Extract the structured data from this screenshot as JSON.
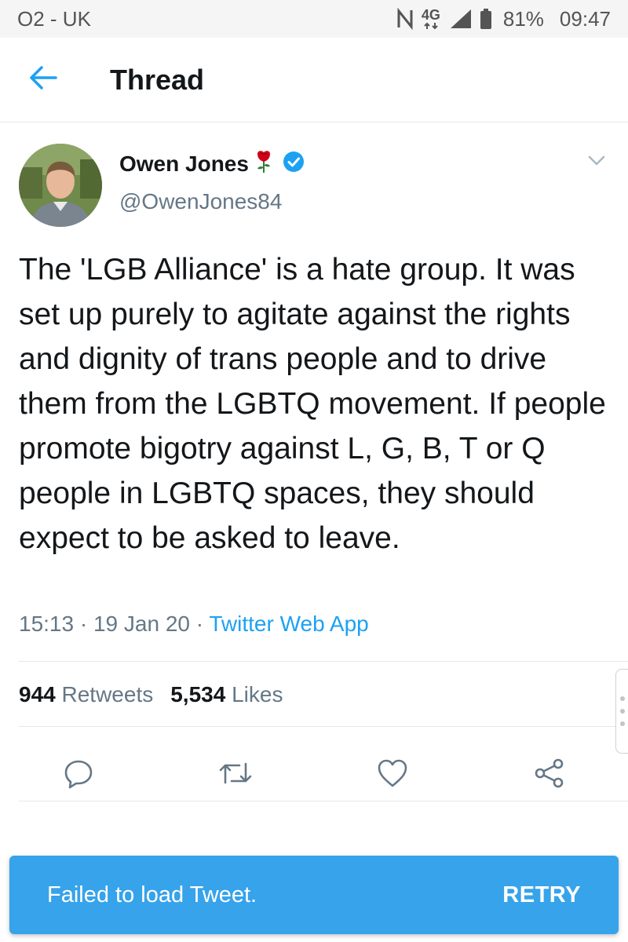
{
  "status_bar": {
    "carrier": "O2 - UK",
    "network": "4G",
    "battery": "81%",
    "time": "09:47",
    "icons": [
      "nfc-icon",
      "network-4g-icon",
      "signal-icon",
      "battery-icon"
    ]
  },
  "header": {
    "back_icon": "arrow-left-icon",
    "title": "Thread"
  },
  "tweet": {
    "display_name": "Owen Jones",
    "handle": "@OwenJones84",
    "name_badges": [
      "rose-icon",
      "verified-badge-icon"
    ],
    "text": "The 'LGB Alliance' is a hate group. It was set up purely to agitate against the rights and dignity of trans people and to drive them from the LGBTQ movement. If people promote bigotry against L, G, B, T or Q people in LGBTQ spaces, they should expect to be asked to leave.",
    "time": "15:13",
    "date": "19 Jan 20",
    "source": "Twitter Web App",
    "retweet_count": "944",
    "retweets_label": "Retweets",
    "like_count": "5,534",
    "likes_label": "Likes"
  },
  "actions": [
    "reply-icon",
    "retweet-icon",
    "like-icon",
    "share-icon"
  ],
  "snackbar": {
    "message": "Failed to load Tweet.",
    "action": "RETRY"
  },
  "colors": {
    "accent": "#1da1f2",
    "snackbar": "#36a3ea",
    "secondary_text": "#657786",
    "rose": "#d0021b",
    "verified": "#1da1f2"
  }
}
